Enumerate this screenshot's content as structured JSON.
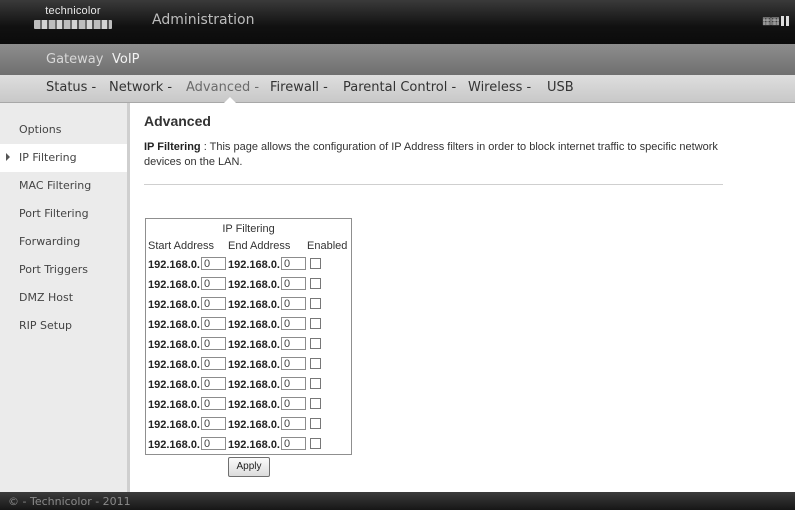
{
  "header": {
    "logo_text": "technicolor",
    "title": "Administration"
  },
  "top_menu": {
    "items": [
      {
        "label": "Gateway",
        "active": false
      },
      {
        "label": "VoIP",
        "active": true
      }
    ]
  },
  "nav": {
    "items": [
      {
        "label": "Status -",
        "active": false
      },
      {
        "label": "Network -",
        "active": false
      },
      {
        "label": "Advanced -",
        "active": true
      },
      {
        "label": "Firewall -",
        "active": false
      },
      {
        "label": "Parental Control -",
        "active": false
      },
      {
        "label": "Wireless -",
        "active": false
      },
      {
        "label": "USB",
        "active": false
      }
    ]
  },
  "sidebar": {
    "items": [
      {
        "label": "Options",
        "active": false
      },
      {
        "label": "IP Filtering",
        "active": true
      },
      {
        "label": "MAC Filtering",
        "active": false
      },
      {
        "label": "Port Filtering",
        "active": false
      },
      {
        "label": "Forwarding",
        "active": false
      },
      {
        "label": "Port Triggers",
        "active": false
      },
      {
        "label": "DMZ Host",
        "active": false
      },
      {
        "label": "RIP Setup",
        "active": false
      }
    ]
  },
  "main": {
    "heading": "Advanced",
    "desc_label": "IP Filtering",
    "desc_sep": ":",
    "desc_text": "This page allows the configuration of IP Address filters in order to block internet traffic to specific network devices on the LAN.",
    "table": {
      "title": "IP Filtering",
      "col_start": "Start Address",
      "col_end": "End Address",
      "col_enabled": "Enabled",
      "prefix": "192.168.0.",
      "rows": [
        {
          "start": "0",
          "end": "0",
          "enabled": false
        },
        {
          "start": "0",
          "end": "0",
          "enabled": false
        },
        {
          "start": "0",
          "end": "0",
          "enabled": false
        },
        {
          "start": "0",
          "end": "0",
          "enabled": false
        },
        {
          "start": "0",
          "end": "0",
          "enabled": false
        },
        {
          "start": "0",
          "end": "0",
          "enabled": false
        },
        {
          "start": "0",
          "end": "0",
          "enabled": false
        },
        {
          "start": "0",
          "end": "0",
          "enabled": false
        },
        {
          "start": "0",
          "end": "0",
          "enabled": false
        },
        {
          "start": "0",
          "end": "0",
          "enabled": false
        }
      ]
    },
    "apply_label": "Apply"
  },
  "footer": {
    "text": "© - Technicolor - 2011"
  },
  "icons": {
    "language": "language-icon",
    "active_item_marker": "triangle-right-icon"
  }
}
